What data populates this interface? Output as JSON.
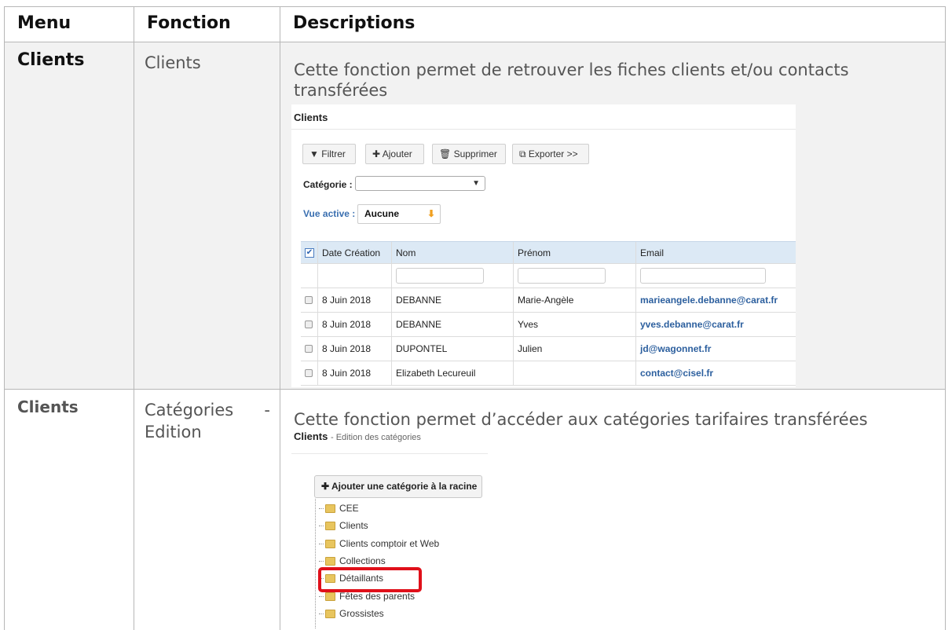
{
  "table": {
    "headers": {
      "menu": "Menu",
      "fonction": "Fonction",
      "descriptions": "Descriptions"
    },
    "rows": [
      {
        "menu": "Clients",
        "fonction": "Clients",
        "description": "Cette fonction permet de retrouver les fiches clients et/ou contacts transférées"
      },
      {
        "menu": "Clients",
        "fonction_line1": "Catégories",
        "fonction_dash": "-",
        "fonction_line2": "Edition",
        "description": "Cette fonction permet d’accéder aux catégories tarifaires transférées"
      }
    ]
  },
  "shot1": {
    "title": "Clients",
    "buttons": {
      "filter": "Filtrer",
      "add": "Ajouter",
      "delete": "Supprimer",
      "export": "Exporter >>"
    },
    "categorie_label": "Catégorie :",
    "vue_label": "Vue active :",
    "vue_value": "Aucune",
    "columns": [
      "Date Création",
      "Nom",
      "Prénom",
      "Email"
    ],
    "rows": [
      {
        "date": "8 Juin 2018",
        "nom": "DEBANNE",
        "prenom": "Marie-Angèle",
        "email": "marieangele.debanne@carat.fr"
      },
      {
        "date": "8 Juin 2018",
        "nom": "DEBANNE",
        "prenom": "Yves",
        "email": "yves.debanne@carat.fr"
      },
      {
        "date": "8 Juin 2018",
        "nom": "DUPONTEL",
        "prenom": "Julien",
        "email": "jd@wagonnet.fr"
      },
      {
        "date": "8 Juin 2018",
        "nom": "Elizabeth Lecureuil",
        "prenom": "",
        "email": "contact@cisel.fr"
      }
    ]
  },
  "shot2": {
    "title": "Clients",
    "subtitle": "- Edition des catégories",
    "add_button": "Ajouter une catégorie à la racine",
    "tree": [
      "CEE",
      "Clients",
      "Clients comptoir et Web",
      "Collections",
      "Détaillants",
      "Fêtes des parents",
      "Grossistes"
    ],
    "highlight_color": "#e0101a"
  }
}
